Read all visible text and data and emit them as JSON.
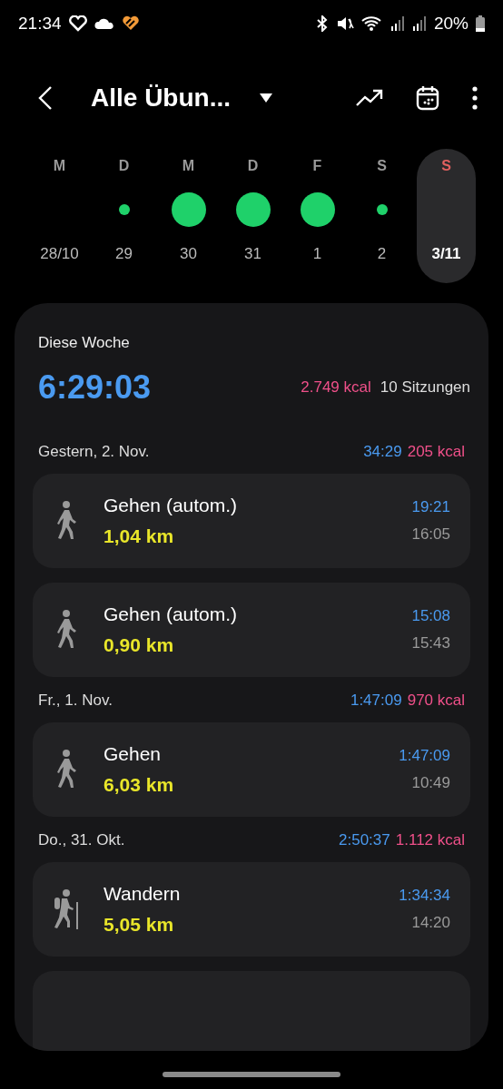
{
  "status_bar": {
    "time": "21:34",
    "battery": "20%"
  },
  "header": {
    "title": "Alle Übun..."
  },
  "week": [
    {
      "letter": "M",
      "date": "28/10",
      "kind": "none",
      "holiday": false,
      "selected": false
    },
    {
      "letter": "D",
      "date": "29",
      "kind": "small",
      "holiday": false,
      "selected": false
    },
    {
      "letter": "M",
      "date": "30",
      "kind": "large",
      "holiday": false,
      "selected": false
    },
    {
      "letter": "D",
      "date": "31",
      "kind": "large",
      "holiday": false,
      "selected": false
    },
    {
      "letter": "F",
      "date": "1",
      "kind": "large",
      "holiday": false,
      "selected": false
    },
    {
      "letter": "S",
      "date": "2",
      "kind": "small",
      "holiday": false,
      "selected": false
    },
    {
      "letter": "S",
      "date": "3/11",
      "kind": "none",
      "holiday": true,
      "selected": true
    }
  ],
  "summary": {
    "label": "Diese Woche",
    "duration": "6:29:03",
    "calories": "2.749 kcal",
    "sessions": "10 Sitzungen"
  },
  "days": [
    {
      "date": "Gestern, 2. Nov.",
      "duration": "34:29",
      "calories": "205 kcal",
      "activities": [
        {
          "kind": "walk",
          "name": "Gehen (autom.)",
          "distance": "1,04 km",
          "duration": "19:21",
          "start": "16:05"
        },
        {
          "kind": "walk",
          "name": "Gehen (autom.)",
          "distance": "0,90 km",
          "duration": "15:08",
          "start": "15:43"
        }
      ]
    },
    {
      "date": "Fr., 1. Nov.",
      "duration": "1:47:09",
      "calories": "970 kcal",
      "activities": [
        {
          "kind": "walk",
          "name": "Gehen",
          "distance": "6,03 km",
          "duration": "1:47:09",
          "start": "10:49"
        }
      ]
    },
    {
      "date": "Do., 31. Okt.",
      "duration": "2:50:37",
      "calories": "1.112 kcal",
      "activities": [
        {
          "kind": "hike",
          "name": "Wandern",
          "distance": "5,05 km",
          "duration": "1:34:34",
          "start": "14:20"
        }
      ]
    }
  ]
}
